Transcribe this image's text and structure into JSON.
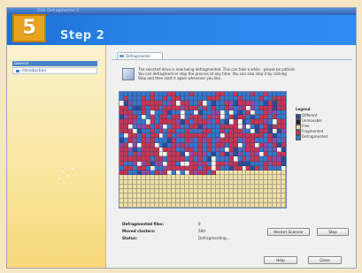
{
  "window": {
    "title": "Disk Defragmenter 2"
  },
  "badge": {
    "number": "5"
  },
  "header": {
    "title": "Step 2"
  },
  "sidebar": {
    "section": "General",
    "items": [
      {
        "label": "Introduction"
      }
    ]
  },
  "tab": {
    "label": "Defragmenter"
  },
  "description": {
    "lines": [
      "The selected drive is now being defragmented. This can take a while - please be patient.",
      "You can defragment or stop the process at any time. You can also stop it by clicking",
      "Stop and then start it again whenever you like."
    ]
  },
  "legend": {
    "title": "Legend",
    "items": [
      {
        "label": "Different",
        "color": "#2b4e99"
      },
      {
        "label": "Unmovable",
        "color": "#222222"
      },
      {
        "label": "Free",
        "color": "#eee0a4"
      },
      {
        "label": "Fragmented",
        "color": "#c43856"
      },
      {
        "label": "Defragmented",
        "color": "#3a77c8"
      }
    ]
  },
  "stats": [
    {
      "key": "Defragmented files:",
      "value": "8"
    },
    {
      "key": "Moved clusters:",
      "value": "584"
    },
    {
      "key": "Status:",
      "value": "Defragmenting..."
    }
  ],
  "buttons": {
    "restart": "Restart Scanner",
    "stop": "Stop",
    "help": "Help",
    "close": "Close"
  }
}
